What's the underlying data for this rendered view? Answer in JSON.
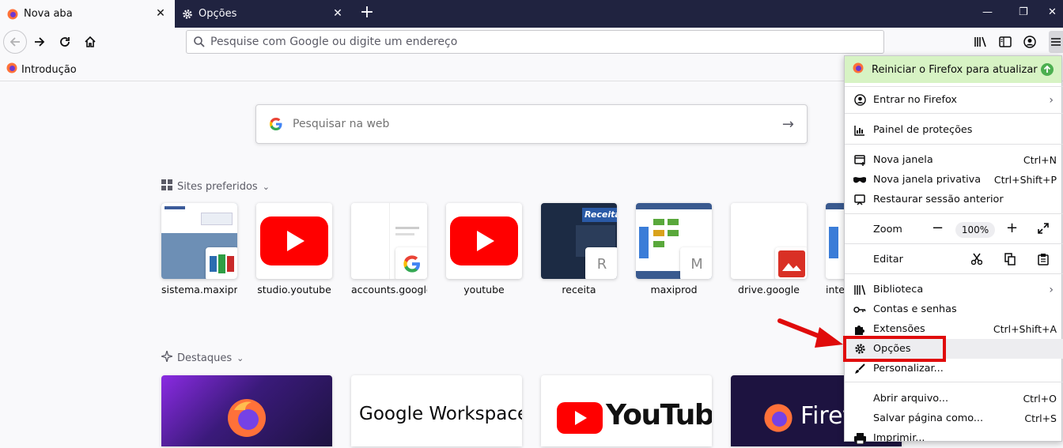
{
  "tabs": [
    {
      "label": "Nova aba",
      "active": true
    },
    {
      "label": "Opções",
      "active": false
    }
  ],
  "url": {
    "placeholder": "Pesquise com Google ou digite um endereço"
  },
  "bookmarks": [
    {
      "label": "Introdução"
    }
  ],
  "search": {
    "placeholder": "Pesquisar na web"
  },
  "top_sites": {
    "heading": "Sites preferidos",
    "tiles": [
      {
        "label": "sistema.maxipr..."
      },
      {
        "label": "studio.youtube"
      },
      {
        "label": "accounts.google"
      },
      {
        "label": "youtube"
      },
      {
        "label": "receita",
        "badge": "R"
      },
      {
        "label": "maxiprod",
        "badge": "M"
      },
      {
        "label": "drive.google"
      },
      {
        "label": "inter"
      }
    ]
  },
  "highlights": {
    "heading": "Destaques",
    "cards": [
      "Google Workspace",
      "YouTube",
      "Firef"
    ]
  },
  "receita_thumb_text": "Receita",
  "menu": {
    "update": "Reiniciar o Firefox para atualizar",
    "signin": "Entrar no Firefox",
    "protections": "Painel de proteções",
    "new_window": {
      "label": "Nova janela",
      "shortcut": "Ctrl+N"
    },
    "private_window": {
      "label": "Nova janela privativa",
      "shortcut": "Ctrl+Shift+P"
    },
    "restore": {
      "label": "Restaurar sessão anterior"
    },
    "zoom": {
      "label": "Zoom",
      "value": "100%"
    },
    "edit": {
      "label": "Editar"
    },
    "library": {
      "label": "Biblioteca"
    },
    "logins": {
      "label": "Contas e senhas"
    },
    "addons": {
      "label": "Extensões",
      "shortcut": "Ctrl+Shift+A"
    },
    "options": {
      "label": "Opções"
    },
    "customize": {
      "label": "Personalizar..."
    },
    "open_file": {
      "label": "Abrir arquivo...",
      "shortcut": "Ctrl+O"
    },
    "save_page": {
      "label": "Salvar página como...",
      "shortcut": "Ctrl+S"
    },
    "print": {
      "label": "Imprimir..."
    }
  },
  "colors": {
    "accent_red": "#e00b0b",
    "tabbar": "#202340",
    "update_bg": "#d7f3c4"
  }
}
